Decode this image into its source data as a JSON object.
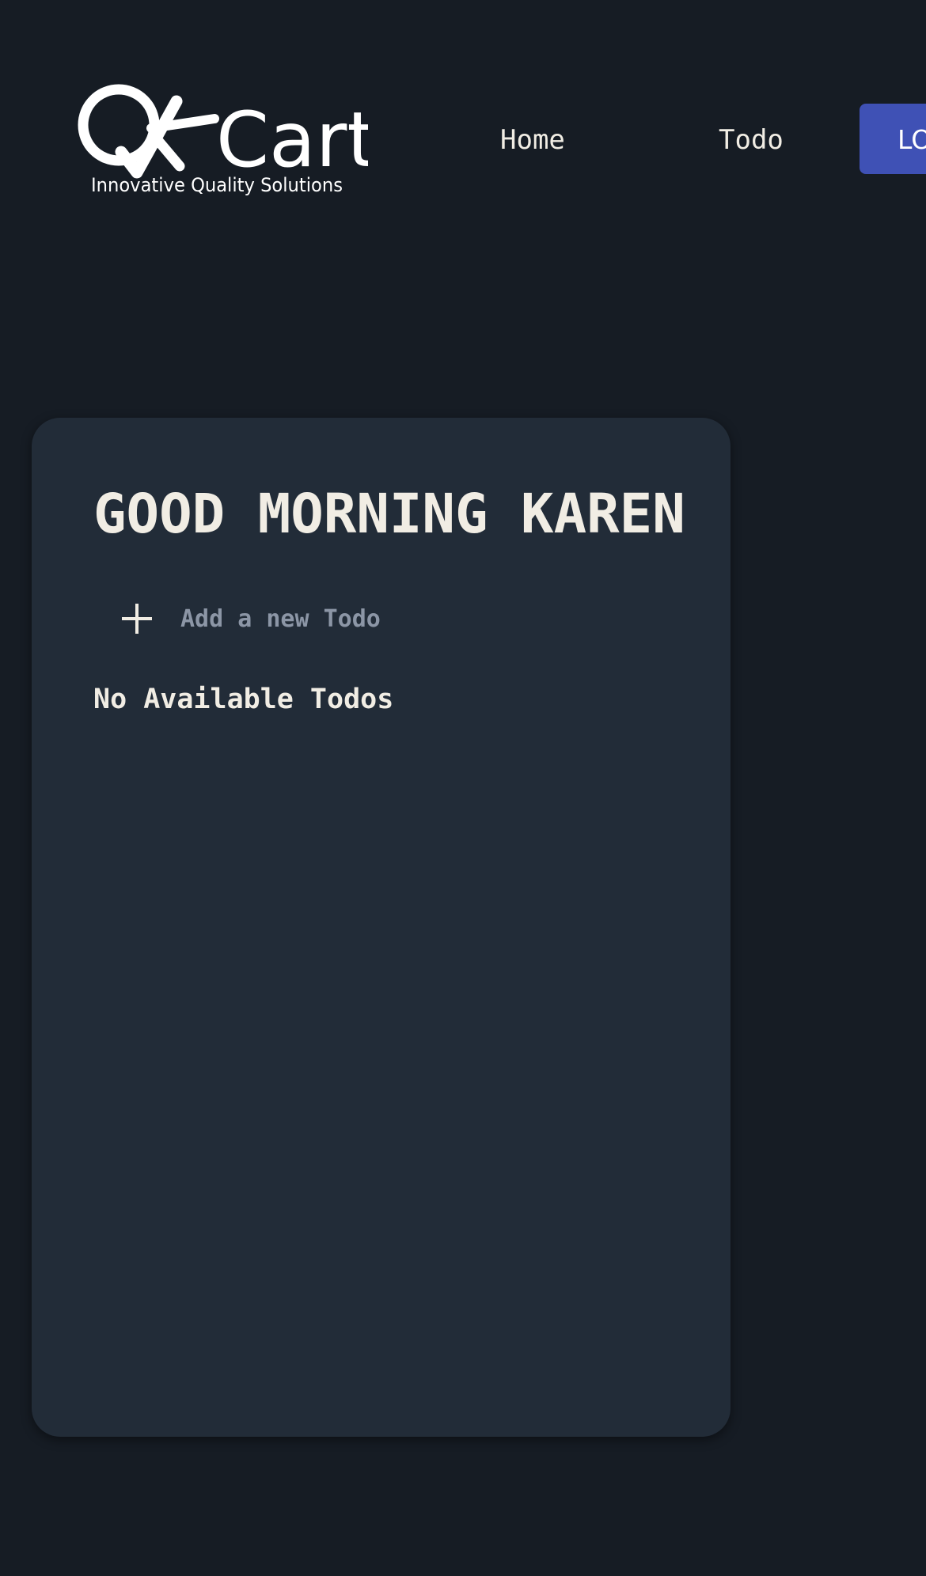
{
  "header": {
    "logo": {
      "mark_text": "QA",
      "wordmark": "Cart",
      "tagline": "Innovative Quality Solutions"
    },
    "nav": {
      "home_label": "Home",
      "todo_label": "Todo"
    },
    "logout_label": "LOGOUT"
  },
  "main": {
    "greeting": "GOOD MORNING KAREN",
    "add_todo": {
      "placeholder": "Add a new Todo",
      "value": "",
      "icon": "plus-icon"
    },
    "empty_message": "No Available Todos"
  },
  "colors": {
    "page_background": "#161c24",
    "card_background": "#222c38",
    "text": "#f1ede4",
    "placeholder": "#8c96a6",
    "logout_button": "#3f51b5"
  }
}
